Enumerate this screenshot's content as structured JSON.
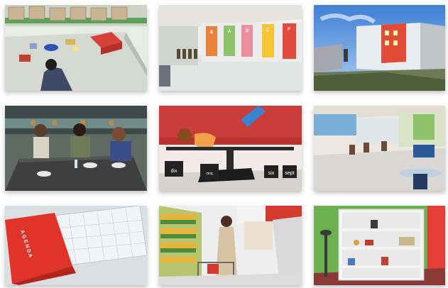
{
  "tiles": {
    "hallway_doors": [
      "B",
      "A",
      "D",
      "C",
      "F"
    ],
    "scale_weights": [
      "dix",
      "cinq",
      "six",
      "sept"
    ],
    "agenda_label": "AGENDA"
  }
}
